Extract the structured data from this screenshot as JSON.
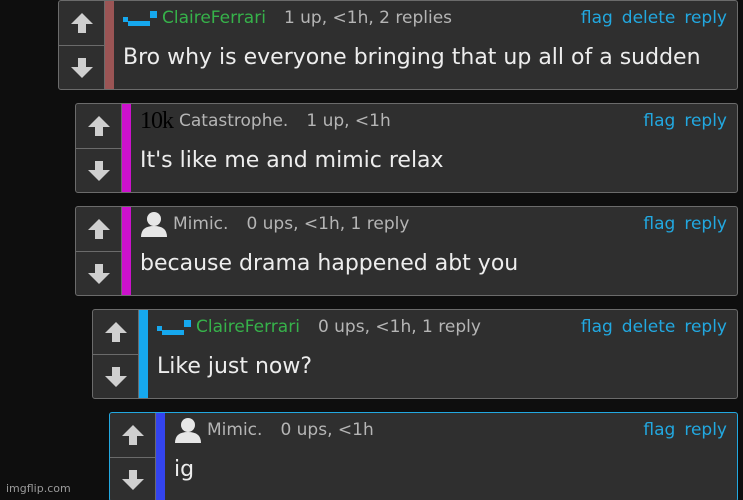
{
  "comments": [
    {
      "username": "ClaireFerrari",
      "user_color": "#36b24a",
      "avatar_icon": "mod-badge-icon",
      "meta": "1 up, <1h, 2 replies",
      "actions": [
        "flag",
        "delete",
        "reply"
      ],
      "text": "Bro why is everyone bringing that up all of a sudden",
      "bar_color": "#9b5555"
    },
    {
      "username": "Catastrophe.",
      "user_color": "#b5b5b5",
      "badge": "10k",
      "meta": "1 up, <1h",
      "actions": [
        "flag",
        "reply"
      ],
      "text": "It's like me and mimic relax",
      "bar_color": "#cc12cc"
    },
    {
      "username": "Mimic.",
      "user_color": "#b5b5b5",
      "avatar_icon": "default-avatar-icon",
      "meta": "0 ups, <1h, 1 reply",
      "actions": [
        "flag",
        "reply"
      ],
      "text": "because drama happened abt you",
      "bar_color": "#cc12cc"
    },
    {
      "username": "ClaireFerrari",
      "user_color": "#36b24a",
      "avatar_icon": "mod-badge-icon",
      "meta": "0 ups, <1h, 1 reply",
      "actions": [
        "flag",
        "delete",
        "reply"
      ],
      "text": "Like just now?",
      "bar_color": "#16a8ee"
    },
    {
      "username": "Mimic.",
      "user_color": "#b5b5b5",
      "avatar_icon": "default-avatar-icon",
      "meta": "0 ups, <1h",
      "actions": [
        "flag",
        "reply"
      ],
      "text": "ig",
      "bar_color": "#3344ee"
    }
  ],
  "watermark": "imgflip.com",
  "colors": {
    "background": "#0e0e0e",
    "card": "#2f2f2f",
    "border": "#6b6b6b",
    "link": "#22a8e0",
    "meta": "#b5b5b5"
  }
}
